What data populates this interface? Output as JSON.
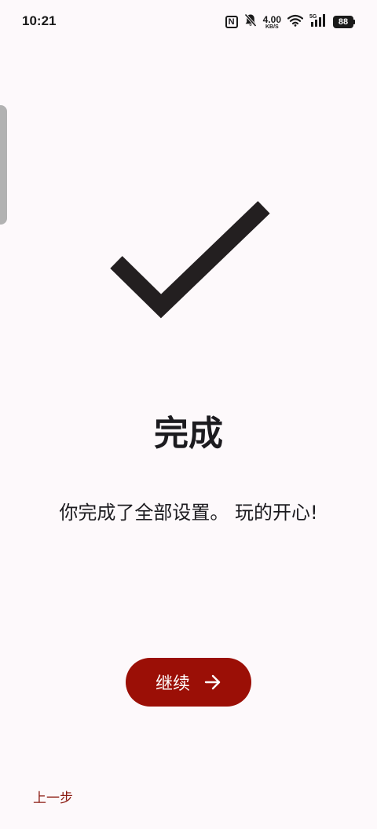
{
  "status_bar": {
    "time": "10:21",
    "nfc_letter": "N",
    "net_speed_value": "4.00",
    "net_speed_unit": "KB/S",
    "cell_label": "5G",
    "battery_level": "88",
    "icons": [
      "nfc-icon",
      "bell-off-icon",
      "wifi-icon",
      "signal-icon",
      "battery-icon"
    ]
  },
  "main": {
    "icon": "checkmark-icon",
    "title": "完成",
    "message": "你完成了全部设置。 玩的开心!",
    "continue_label": "继续",
    "continue_icon": "arrow-right-icon",
    "back_label": "上一步"
  },
  "colors": {
    "accent": "#9b0f06",
    "back_link": "#8b1a10",
    "background": "#fdf9fb",
    "text": "#1c1b1f"
  }
}
